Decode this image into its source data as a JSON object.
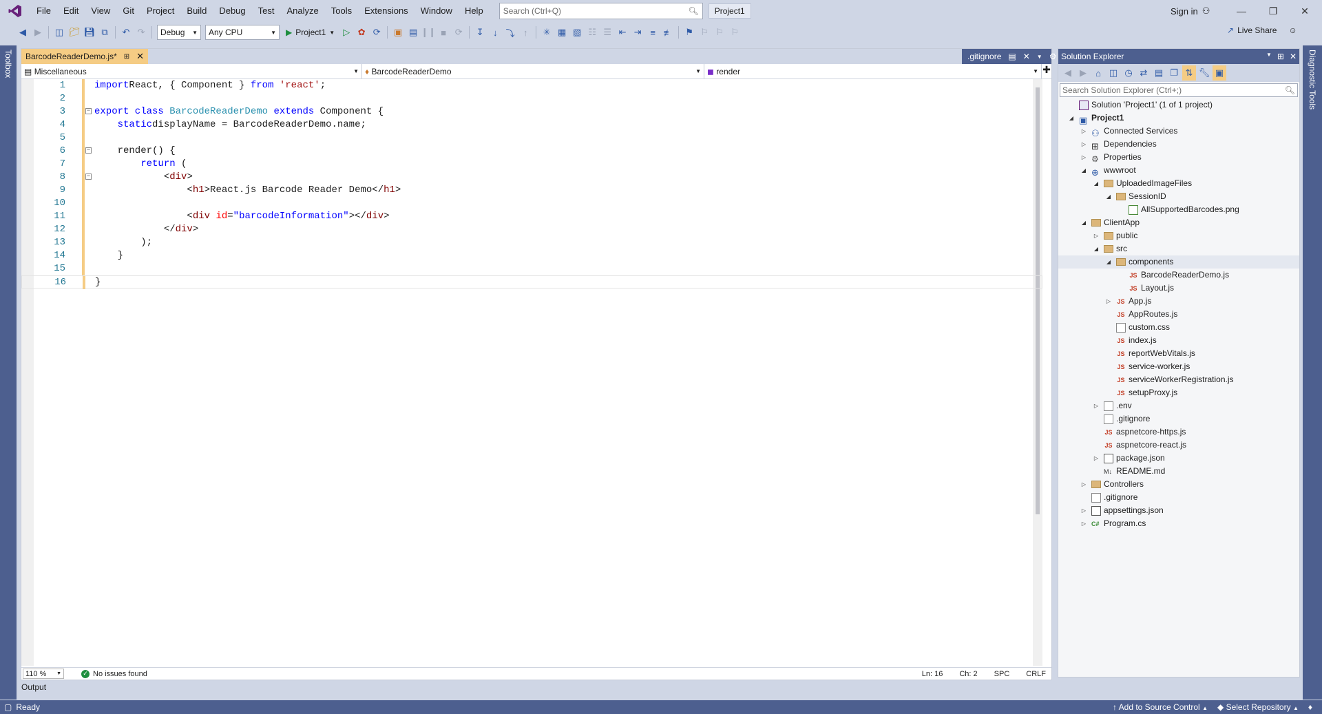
{
  "menu": [
    "File",
    "Edit",
    "View",
    "Git",
    "Project",
    "Build",
    "Debug",
    "Test",
    "Analyze",
    "Tools",
    "Extensions",
    "Window",
    "Help"
  ],
  "search": {
    "placeholder": "Search (Ctrl+Q)"
  },
  "project_badge": "Project1",
  "signin": "Sign in",
  "toolbar": {
    "config": "Debug",
    "platform": "Any CPU",
    "start_label": "Project1",
    "live_share": "Live Share"
  },
  "rails": {
    "left": "Toolbox",
    "right": "Diagnostic Tools"
  },
  "editor": {
    "active_tab": "BarcodeReaderDemo.js*",
    "preview_tab": ".gitignore",
    "nav": {
      "project": "Miscellaneous",
      "type": "BarcodeReaderDemo",
      "member": "render"
    },
    "lines": [
      {
        "n": "1",
        "fold": "",
        "tokens": [
          [
            "kw",
            "import"
          ],
          [
            "",
            "React, { Component } "
          ],
          [
            "kw",
            "from"
          ],
          [
            "",
            ""
          ],
          [
            "str",
            " 'react'"
          ],
          [
            "",
            ";"
          ]
        ]
      },
      {
        "n": "2",
        "fold": "",
        "tokens": []
      },
      {
        "n": "3",
        "fold": "−",
        "tokens": [
          [
            "kw",
            "export class "
          ],
          [
            "cls",
            "BarcodeReaderDemo"
          ],
          [
            "kw",
            " extends "
          ],
          [
            "",
            "Component {"
          ]
        ]
      },
      {
        "n": "4",
        "fold": "",
        "tokens": [
          [
            "",
            "    "
          ],
          [
            "kw",
            "static"
          ],
          [
            "",
            ""
          ],
          [
            "",
            "displayName = BarcodeReaderDemo.name;"
          ]
        ]
      },
      {
        "n": "5",
        "fold": "",
        "tokens": []
      },
      {
        "n": "6",
        "fold": "−",
        "tokens": [
          [
            "",
            "    render() {"
          ]
        ]
      },
      {
        "n": "7",
        "fold": "",
        "tokens": [
          [
            "",
            "        "
          ],
          [
            "kw",
            "return"
          ],
          [
            "",
            " ("
          ]
        ]
      },
      {
        "n": "8",
        "fold": "−",
        "tokens": [
          [
            "",
            "            <"
          ],
          [
            "tag",
            "div"
          ],
          [
            "",
            ">"
          ]
        ]
      },
      {
        "n": "9",
        "fold": "",
        "tokens": [
          [
            "",
            "                <"
          ],
          [
            "tag",
            "h1"
          ],
          [
            "",
            ">React.js Barcode Reader Demo</"
          ],
          [
            "tag",
            "h1"
          ],
          [
            "",
            ">"
          ]
        ]
      },
      {
        "n": "10",
        "fold": "",
        "tokens": []
      },
      {
        "n": "11",
        "fold": "",
        "tokens": [
          [
            "",
            "                <"
          ],
          [
            "tag",
            "div"
          ],
          [
            "",
            " "
          ],
          [
            "attr",
            "id"
          ],
          [
            "",
            "="
          ],
          [
            "kw",
            "\"barcodeInformation\""
          ],
          [
            "",
            "></"
          ],
          [
            "tag",
            "div"
          ],
          [
            "",
            ">"
          ]
        ]
      },
      {
        "n": "12",
        "fold": "",
        "tokens": [
          [
            "",
            "            </"
          ],
          [
            "tag",
            "div"
          ],
          [
            "",
            ">"
          ]
        ]
      },
      {
        "n": "13",
        "fold": "",
        "tokens": [
          [
            "",
            "        );"
          ]
        ]
      },
      {
        "n": "14",
        "fold": "",
        "tokens": [
          [
            "",
            "    }"
          ]
        ]
      },
      {
        "n": "15",
        "fold": "",
        "tokens": []
      },
      {
        "n": "16",
        "fold": "",
        "tokens": [
          [
            "",
            "}"
          ]
        ]
      }
    ],
    "status": {
      "zoom": "110 %",
      "issues": "No issues found",
      "ln": "Ln: 16",
      "ch": "Ch: 2",
      "spc": "SPC",
      "eol": "CRLF"
    }
  },
  "output_label": "Output",
  "solution_explorer": {
    "title": "Solution Explorer",
    "search_placeholder": "Search Solution Explorer (Ctrl+;)",
    "nodes": [
      {
        "depth": 0,
        "exp": "",
        "icon": "solution",
        "label": "Solution 'Project1' (1 of 1 project)"
      },
      {
        "depth": 0,
        "exp": "open",
        "icon": "project",
        "label": "Project1",
        "bold": true
      },
      {
        "depth": 1,
        "exp": "closed",
        "icon": "connected",
        "label": "Connected Services"
      },
      {
        "depth": 1,
        "exp": "closed",
        "icon": "deps",
        "label": "Dependencies"
      },
      {
        "depth": 1,
        "exp": "closed",
        "icon": "props",
        "label": "Properties"
      },
      {
        "depth": 1,
        "exp": "open",
        "icon": "globe",
        "label": "wwwroot"
      },
      {
        "depth": 2,
        "exp": "open",
        "icon": "folder",
        "label": "UploadedImageFiles"
      },
      {
        "depth": 3,
        "exp": "open",
        "icon": "folder",
        "label": "SessionID"
      },
      {
        "depth": 4,
        "exp": "",
        "icon": "image",
        "label": "AllSupportedBarcodes.png"
      },
      {
        "depth": 1,
        "exp": "open",
        "icon": "folder",
        "label": "ClientApp"
      },
      {
        "depth": 2,
        "exp": "closed",
        "icon": "folder",
        "label": "public"
      },
      {
        "depth": 2,
        "exp": "open",
        "icon": "folder",
        "label": "src"
      },
      {
        "depth": 3,
        "exp": "open",
        "icon": "folder",
        "label": "components",
        "selected": true
      },
      {
        "depth": 4,
        "exp": "",
        "icon": "js",
        "label": "BarcodeReaderDemo.js"
      },
      {
        "depth": 4,
        "exp": "",
        "icon": "js",
        "label": "Layout.js"
      },
      {
        "depth": 3,
        "exp": "closed",
        "icon": "js",
        "label": "App.js"
      },
      {
        "depth": 3,
        "exp": "",
        "icon": "js",
        "label": "AppRoutes.js"
      },
      {
        "depth": 3,
        "exp": "",
        "icon": "css",
        "label": "custom.css"
      },
      {
        "depth": 3,
        "exp": "",
        "icon": "js",
        "label": "index.js"
      },
      {
        "depth": 3,
        "exp": "",
        "icon": "js",
        "label": "reportWebVitals.js"
      },
      {
        "depth": 3,
        "exp": "",
        "icon": "js",
        "label": "service-worker.js"
      },
      {
        "depth": 3,
        "exp": "",
        "icon": "js",
        "label": "serviceWorkerRegistration.js"
      },
      {
        "depth": 3,
        "exp": "",
        "icon": "js",
        "label": "setupProxy.js"
      },
      {
        "depth": 2,
        "exp": "closed",
        "icon": "file",
        "label": ".env"
      },
      {
        "depth": 2,
        "exp": "",
        "icon": "file",
        "label": ".gitignore"
      },
      {
        "depth": 2,
        "exp": "",
        "icon": "js",
        "label": "aspnetcore-https.js"
      },
      {
        "depth": 2,
        "exp": "",
        "icon": "js",
        "label": "aspnetcore-react.js"
      },
      {
        "depth": 2,
        "exp": "closed",
        "icon": "json",
        "label": "package.json"
      },
      {
        "depth": 2,
        "exp": "",
        "icon": "md",
        "label": "README.md"
      },
      {
        "depth": 1,
        "exp": "closed",
        "icon": "folder",
        "label": "Controllers"
      },
      {
        "depth": 1,
        "exp": "",
        "icon": "file",
        "label": ".gitignore"
      },
      {
        "depth": 1,
        "exp": "closed",
        "icon": "json",
        "label": "appsettings.json"
      },
      {
        "depth": 1,
        "exp": "closed",
        "icon": "cs",
        "label": "Program.cs"
      }
    ]
  },
  "statusbar": {
    "ready": "Ready",
    "source_control": "Add to Source Control",
    "repository": "Select Repository"
  },
  "colors": {
    "accent": "#4d5f8f",
    "chrome": "#cfd6e5",
    "active_tab": "#f5cc84",
    "logo": "#68217a"
  }
}
